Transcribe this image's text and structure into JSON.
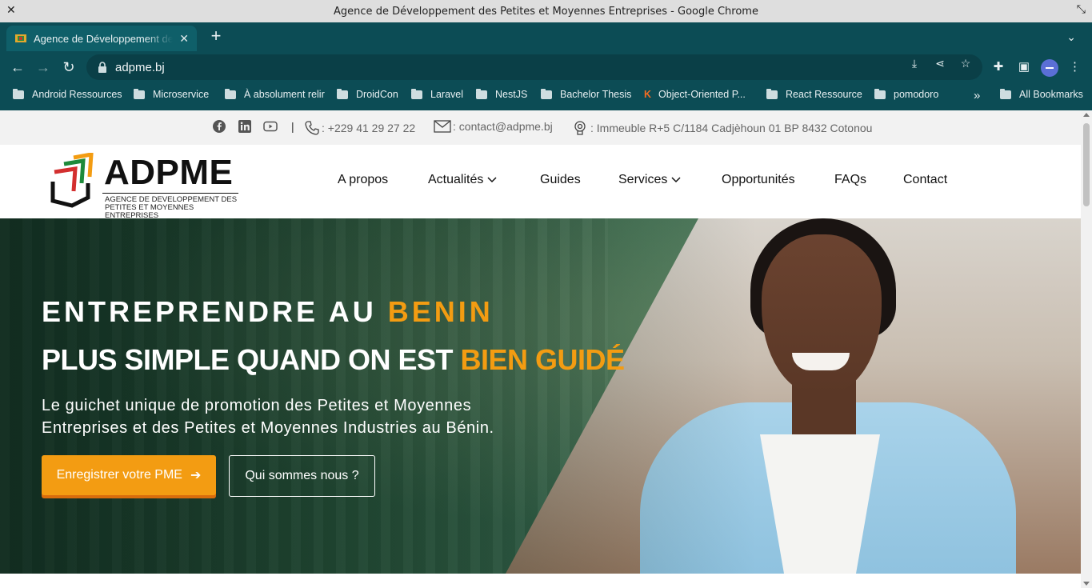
{
  "window": {
    "title": "Agence de Développement des Petites et Moyennes Entreprises - Google Chrome"
  },
  "tab": {
    "title": "Agence de Développement des Petites et Moyennes Entreprises"
  },
  "omnibox": {
    "url": "adpme.bj"
  },
  "bookmarks": {
    "items": [
      "Android Ressources",
      "Microservice",
      "À absolument relir",
      "DroidCon",
      "Laravel",
      "NestJS",
      "Bachelor Thesis",
      "Object-Oriented P...",
      "React Ressource",
      "pomodoro"
    ],
    "more": "»",
    "all": "All Bookmarks"
  },
  "topbar": {
    "phone": ": +229 41 29 27 22",
    "email": ": contact@adpme.bj",
    "address": ": Immeuble R+5 C/1184 Cadjèhoun 01 BP 8432 Cotonou",
    "separator": "|"
  },
  "logo": {
    "brand": "ADPME",
    "line1": "AGENCE DE DEVELOPPEMENT DES",
    "line2": "PETITES ET MOYENNES ENTREPRISES"
  },
  "nav": [
    "A propos",
    "Actualités",
    "Guides",
    "Services",
    "Opportunités",
    "FAQs",
    "Contact"
  ],
  "hero": {
    "line1_a": "ENTREPRENDRE AU ",
    "line1_b": "BENIN",
    "line2_a": "PLUS SIMPLE QUAND ON EST ",
    "line2_b": "BIEN GUIDÉ",
    "lead": "Le guichet unique de promotion des Petites et Moyennes Entreprises et des Petites et Moyennes Industries au Bénin.",
    "cta_primary": "Enregistrer votre PME",
    "cta_secondary": "Qui sommes nous ?"
  },
  "colors": {
    "chrome": "#0c4c55",
    "accent": "#f39c12"
  }
}
